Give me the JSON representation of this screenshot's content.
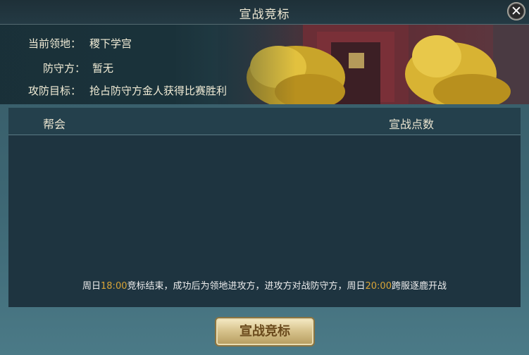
{
  "window": {
    "title": "宣战竞标"
  },
  "info": {
    "territory_label": "当前领地：",
    "territory_value": "稷下学宫",
    "defender_label": "防守方：",
    "defender_value": "暂无",
    "goal_label": "攻防目标：",
    "goal_value": "抢占防守方金人获得比赛胜利"
  },
  "table": {
    "columns": [
      "帮会",
      "宣战点数"
    ],
    "rows": []
  },
  "notice": {
    "part1": "周日",
    "time1": "18:00",
    "part2": "竞标结束，成功后为领地进攻方，进攻方对战防守方，周日",
    "time2": "20:00",
    "part3": "跨服逐鹿开战"
  },
  "button": {
    "label": "宣战竞标"
  },
  "colors": {
    "gold_text": "#d9a437",
    "panel": "#1e3440",
    "title_bar": "#1e3038"
  },
  "icons": {
    "close": "close-icon"
  }
}
